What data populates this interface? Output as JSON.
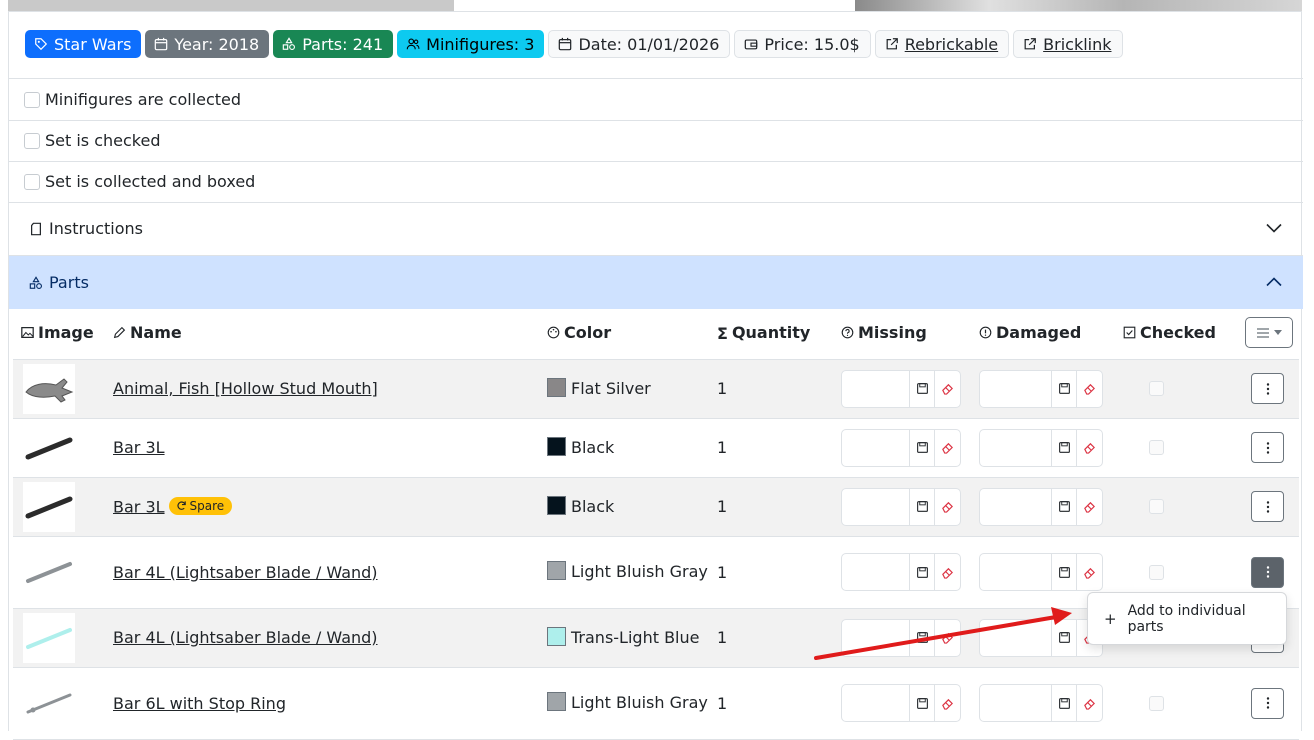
{
  "badges": [
    {
      "label": "Star Wars",
      "icon": "tag-icon",
      "style": "primary"
    },
    {
      "label": "Year: 2018",
      "icon": "calendar-icon",
      "style": "secondary"
    },
    {
      "label": "Parts: 241",
      "icon": "shapes-icon",
      "style": "success"
    },
    {
      "label": "Minifigures: 3",
      "icon": "group-icon",
      "style": "info"
    },
    {
      "label": "Date: 01/01/2026",
      "icon": "calendar-icon",
      "style": "light"
    },
    {
      "label": "Price: 15.0$",
      "icon": "wallet-icon",
      "style": "light"
    },
    {
      "label": "Rebrickable",
      "icon": "external-link-icon",
      "style": "light-link"
    },
    {
      "label": "Bricklink",
      "icon": "external-link-icon",
      "style": "light-link"
    }
  ],
  "checkboxes": {
    "minifigures": "Minifigures are collected",
    "checked": "Set is checked",
    "boxed": "Set is collected and boxed"
  },
  "accordion": {
    "instructions": "Instructions",
    "parts": "Parts"
  },
  "table": {
    "headers": {
      "image": "Image",
      "name": "Name",
      "color": "Color",
      "quantity": "Quantity",
      "missing": "Missing",
      "damaged": "Damaged",
      "checked": "Checked"
    },
    "spare_label": "Spare",
    "rows": [
      {
        "name": "Animal, Fish [Hollow Stud Mouth]",
        "color": "Flat Silver",
        "swatch": "#898788",
        "quantity": "1",
        "spare": false
      },
      {
        "name": "Bar 3L",
        "color": "Black",
        "swatch": "#05131D",
        "quantity": "1",
        "spare": false
      },
      {
        "name": "Bar 3L",
        "color": "Black",
        "swatch": "#05131D",
        "quantity": "1",
        "spare": true
      },
      {
        "name": "Bar 4L (Lightsaber Blade / Wand)",
        "color": "Light Bluish Gray",
        "swatch": "#A0A5A9",
        "quantity": "1",
        "spare": false
      },
      {
        "name": "Bar 4L (Lightsaber Blade / Wand)",
        "color": "Trans-Light Blue",
        "swatch": "#AEEFEC",
        "quantity": "1",
        "spare": false
      },
      {
        "name": "Bar 6L with Stop Ring",
        "color": "Light Bluish Gray",
        "swatch": "#A0A5A9",
        "quantity": "1",
        "spare": false
      }
    ]
  },
  "dropdown": {
    "item": "Add to individual parts"
  },
  "colors": {
    "annotation_arrow": "#e01b1b",
    "accordion_active": "#cfe2ff"
  }
}
